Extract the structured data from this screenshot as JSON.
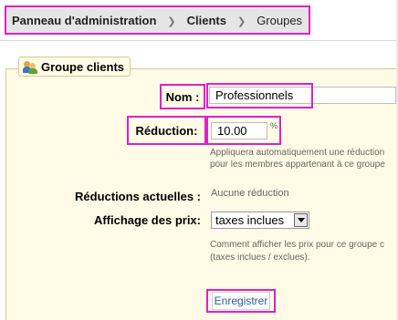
{
  "breadcrumb": {
    "items": [
      "Panneau d'administration",
      "Clients",
      "Groupes"
    ]
  },
  "section": {
    "title": "Groupe clients",
    "icon": "users-group-icon"
  },
  "form": {
    "name_label": "Nom :",
    "name_value": "Professionnels",
    "name_suffix": "*",
    "reduction_label": "Réduction:",
    "reduction_value": "10.00",
    "reduction_unit": "%",
    "reduction_help_1": "Appliquera automatiquement une réduction",
    "reduction_help_2": "pour les membres appartenant à ce groupe",
    "current_reductions_label": "Réductions actuelles :",
    "current_reductions_value": "Aucune réduction",
    "price_display_label": "Affichage des prix:",
    "price_display_value": "taxes inclues",
    "price_display_help_1": "Comment afficher les prix pour ce groupe c",
    "price_display_help_2": "(taxes inclues / exclues).",
    "save_label": "Enregistrer"
  },
  "colors": {
    "highlight": "#e020c8",
    "panel_bg": "#fffbe6",
    "link": "#2b5fa8"
  }
}
